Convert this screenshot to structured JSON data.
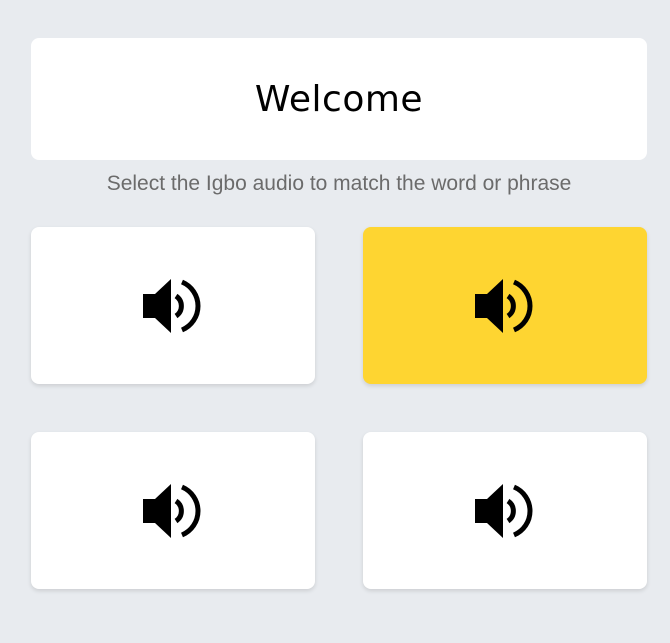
{
  "prompt": {
    "word": "Welcome",
    "instruction": "Select the Igbo audio to match the word or phrase"
  },
  "options": [
    {
      "icon": "speaker-icon",
      "selected": false
    },
    {
      "icon": "speaker-icon",
      "selected": true
    },
    {
      "icon": "speaker-icon",
      "selected": false
    },
    {
      "icon": "speaker-icon",
      "selected": false
    }
  ],
  "colors": {
    "background": "#e8ebef",
    "card": "#ffffff",
    "selected": "#fed531",
    "instruction_text": "#6b6b6b"
  }
}
